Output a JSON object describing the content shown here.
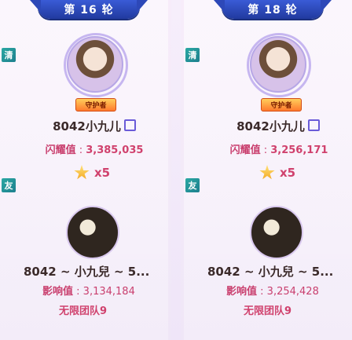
{
  "cards": [
    {
      "round": "第 16 轮",
      "tag_top": "清",
      "badge": "守护者",
      "name": "8042小九儿",
      "stat_label": "闪耀值",
      "stat_value": "3,385,035",
      "multiplier": "x5",
      "tag_bottom": "友",
      "name2": "8042 ~ 小九兒 ~ 5...",
      "stat2_label": "影响值",
      "stat2_value": "3,134,184",
      "sub": "无限团队9"
    },
    {
      "round": "第 18 轮",
      "tag_top": "清",
      "badge": "守护者",
      "name": "8042小九儿",
      "stat_label": "闪耀值",
      "stat_value": "3,256,171",
      "multiplier": "x5",
      "tag_bottom": "友",
      "name2": "8042 ~ 小九兒 ~ 5...",
      "stat2_label": "影响值",
      "stat2_value": "3,254,428",
      "sub": "无限团队9"
    }
  ]
}
